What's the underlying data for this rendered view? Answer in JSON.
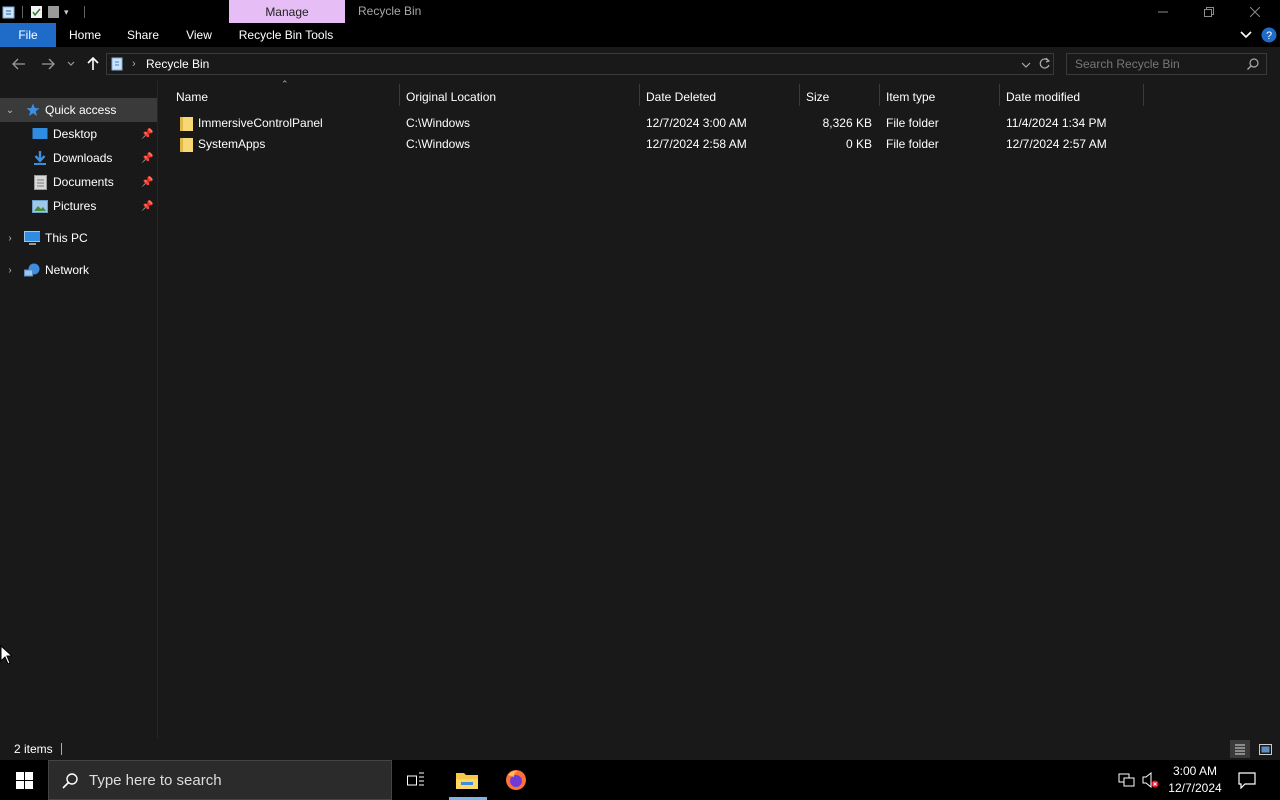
{
  "window": {
    "title": "Recycle Bin",
    "context_tab": "Manage",
    "context_tab_color": "#e7bdf5"
  },
  "ribbon": {
    "tabs": [
      "File",
      "Home",
      "Share",
      "View",
      "Recycle Bin Tools"
    ],
    "file_color": "#1e6cc8"
  },
  "address": {
    "path": "Recycle Bin",
    "search_placeholder": "Search Recycle Bin"
  },
  "sidebar": {
    "quick_access": "Quick access",
    "pinned": [
      {
        "label": "Desktop",
        "icon": "desktop-icon"
      },
      {
        "label": "Downloads",
        "icon": "download-icon"
      },
      {
        "label": "Documents",
        "icon": "document-icon"
      },
      {
        "label": "Pictures",
        "icon": "pictures-icon"
      }
    ],
    "this_pc": "This PC",
    "network": "Network"
  },
  "list": {
    "columns": [
      "Name",
      "Original Location",
      "Date Deleted",
      "Size",
      "Item type",
      "Date modified"
    ],
    "rows": [
      {
        "name": "ImmersiveControlPanel",
        "location": "C:\\Windows",
        "deleted": "12/7/2024 3:00 AM",
        "size": "8,326 KB",
        "type": "File folder",
        "modified": "11/4/2024 1:34 PM"
      },
      {
        "name": "SystemApps",
        "location": "C:\\Windows",
        "deleted": "12/7/2024 2:58 AM",
        "size": "0 KB",
        "type": "File folder",
        "modified": "12/7/2024 2:57 AM"
      }
    ]
  },
  "status": {
    "count": "2 items"
  },
  "taskbar": {
    "search_placeholder": "Type here to search",
    "time": "3:00 AM",
    "date": "12/7/2024"
  }
}
